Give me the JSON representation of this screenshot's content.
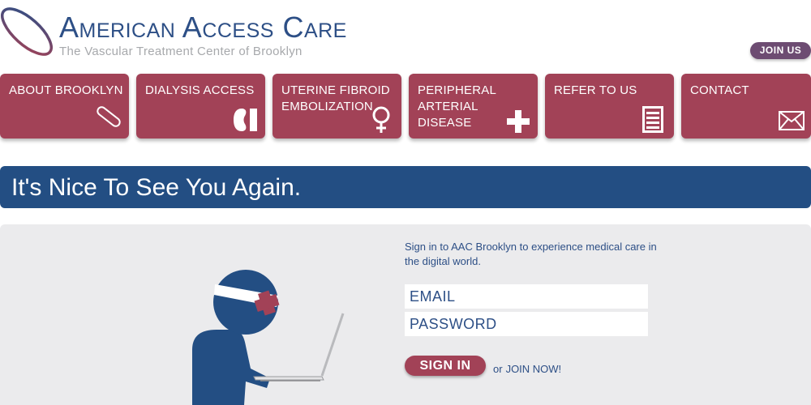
{
  "header": {
    "title": "American Access Care",
    "tagline": "The Vascular Treatment Center of Brooklyn",
    "join_us_label": "JOIN US"
  },
  "nav": {
    "items": [
      {
        "label": "About Brooklyn",
        "icon": "capsule-icon"
      },
      {
        "label": "Dialysis Access",
        "icon": "kidney-icon"
      },
      {
        "label": "Uterine Fibroid Embolization",
        "icon": "female-symbol-icon"
      },
      {
        "label": "Peripheral Arterial Disease",
        "icon": "medical-cross-icon"
      },
      {
        "label": "Refer To Us",
        "icon": "document-list-icon"
      },
      {
        "label": "Contact",
        "icon": "envelope-icon"
      }
    ]
  },
  "banner": {
    "heading": "It's Nice To See You Again."
  },
  "signin": {
    "intro": "Sign in to AAC Brooklyn to experience medical care in the digital world.",
    "email_placeholder": "EMAIL",
    "password_placeholder": "PASSWORD",
    "signin_label": "SIGN IN",
    "or_text": "or",
    "join_now_label": "JOIN NOW!"
  },
  "colors": {
    "brand_blue": "#234e83",
    "brand_red": "#a24257",
    "join_purple": "#6d4c72",
    "panel_gray": "#ebebed"
  }
}
